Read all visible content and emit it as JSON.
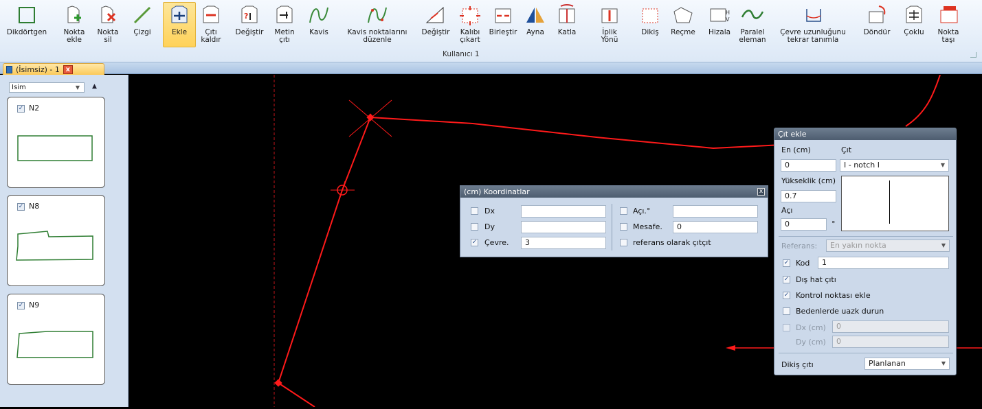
{
  "ribbon": {
    "group_label": "Kullanıcı 1",
    "buttons": [
      {
        "id": "dikdortgen",
        "label": "Dikdörtgen",
        "icon": "rectangle-icon"
      },
      {
        "id": "nokta-ekle",
        "label": "Nokta\nekle",
        "icon": "add-point-icon"
      },
      {
        "id": "nokta-sil",
        "label": "Nokta\nsil",
        "icon": "delete-point-icon"
      },
      {
        "id": "cizgi",
        "label": "Çizgi",
        "icon": "line-icon"
      },
      {
        "id": "ekle",
        "label": "Ekle",
        "icon": "add-notch-icon"
      },
      {
        "id": "citi-kaldir",
        "label": "Çıtı\nkaldır",
        "icon": "remove-notch-icon"
      },
      {
        "id": "degistir",
        "label": "Değiştir",
        "icon": "change-notch-icon"
      },
      {
        "id": "metin-citi",
        "label": "Metin\nçıtı",
        "icon": "text-notch-icon"
      },
      {
        "id": "kavis",
        "label": "Kavis",
        "icon": "curve-icon"
      },
      {
        "id": "kavis-noktalari",
        "label": "Kavis noktalarını\ndüzenle",
        "icon": "edit-curve-points-icon"
      },
      {
        "id": "degistir2",
        "label": "Değiştir",
        "icon": "modify-icon"
      },
      {
        "id": "kalibi-cikart",
        "label": "Kalıbı\nçıkart",
        "icon": "extract-pattern-icon"
      },
      {
        "id": "birlestir",
        "label": "Birleştir",
        "icon": "merge-icon"
      },
      {
        "id": "ayna",
        "label": "Ayna",
        "icon": "mirror-icon"
      },
      {
        "id": "katla",
        "label": "Katla",
        "icon": "fold-icon"
      },
      {
        "id": "iplik-yonu",
        "label": "İplik\nYönü",
        "icon": "grain-line-icon"
      },
      {
        "id": "dikis",
        "label": "Dikiş",
        "icon": "seam-icon"
      },
      {
        "id": "recme",
        "label": "Reçme",
        "icon": "pleat-icon"
      },
      {
        "id": "hizala",
        "label": "Hizala",
        "icon": "align-icon"
      },
      {
        "id": "paralel-eleman",
        "label": "Paralel\neleman",
        "icon": "parallel-icon"
      },
      {
        "id": "cevre-uzunlugu",
        "label": "Çevre uzunluğunu\ntekrar tanımla",
        "icon": "perimeter-icon"
      },
      {
        "id": "dondur",
        "label": "Döndür",
        "icon": "rotate-icon"
      },
      {
        "id": "coklu",
        "label": "Çoklu",
        "icon": "multi-icon"
      },
      {
        "id": "nokta-tasi",
        "label": "Nokta\ntaşı",
        "icon": "move-point-icon"
      }
    ]
  },
  "doc_tab": {
    "title": "(İsimsiz) - 1",
    "close": "x"
  },
  "left_panel": {
    "sort_label": "Isim",
    "pieces": [
      {
        "name": "N2",
        "checked": "✓"
      },
      {
        "name": "N8",
        "checked": "✓"
      },
      {
        "name": "N9",
        "checked": "✓"
      }
    ]
  },
  "coord_dialog": {
    "title": "(cm) Koordinatlar",
    "close": "x",
    "dx_label": "Dx",
    "dx_value": "",
    "dy_label": "Dy",
    "dy_value": "",
    "cevre_label": "Çevre.",
    "cevre_value": "3",
    "cevre_checked": "✓",
    "aci_label": "Açı.°",
    "aci_value": "",
    "mesafe_label": "Mesafe.",
    "mesafe_value": "0",
    "ref_label": "referans olarak çıtçıt"
  },
  "notch_dialog": {
    "title": "Çıt ekle",
    "en_label": "En (cm)",
    "en_value": "0",
    "cit_label": "Çıt",
    "cit_value": "I - notch I",
    "yukseklik_label": "Yükseklik (cm)",
    "yukseklik_value": "0.7",
    "aci_label": "Açı",
    "aci_value": "0",
    "degree": "°",
    "referans_label": "Referans:",
    "referans_value": "En yakın nokta",
    "kod_label": "Kod",
    "kod_value": "1",
    "kod_checked": "✓",
    "dis_hat_label": "Dış hat çıtı",
    "dis_hat_checked": "✓",
    "kontrol_label": "Kontrol noktası ekle",
    "kontrol_checked": "✓",
    "bedenler_label": "Bedenlerde uazk durun",
    "dx_label": "Dx (cm)",
    "dx_value": "0",
    "dy_label": "Dy (cm)",
    "dy_value": "0",
    "dikis_label": "Dikiş çıtı",
    "dikis_value": "Planlanan"
  },
  "colors": {
    "pattern_line": "#ff1a1a",
    "piece_outline": "#2e7d32",
    "accent": "#ffd25a"
  }
}
